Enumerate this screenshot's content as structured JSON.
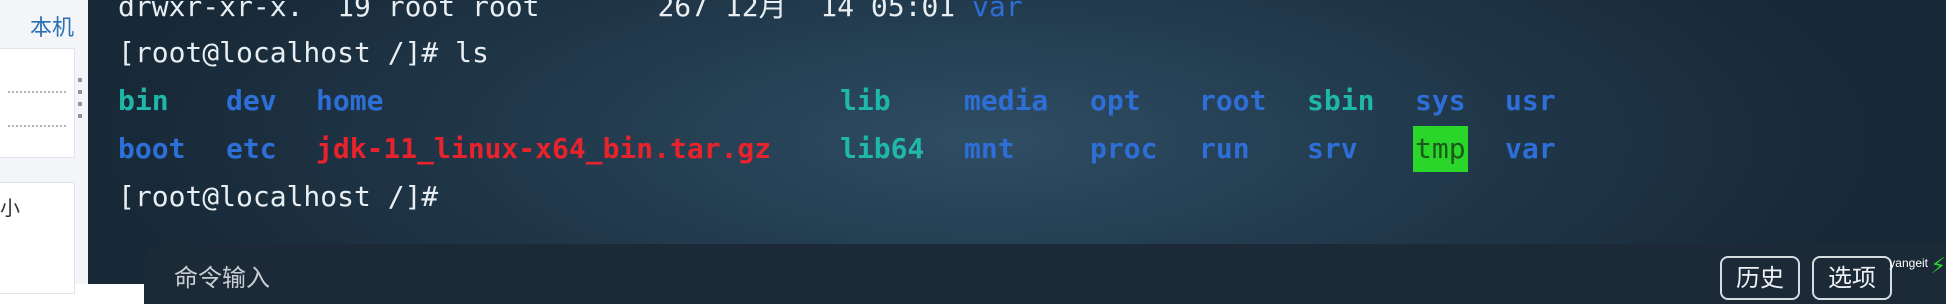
{
  "sidebar": {
    "top_label": "本机",
    "small_label": "小"
  },
  "terminal": {
    "prev_line": {
      "perms": "drwxr-xr-x.  19 root root       267 12月  14 05:01 ",
      "name": "var"
    },
    "prompt1": "[root@localhost /]# ls",
    "prompt2": "[root@localhost /]#",
    "ls_row1": [
      "bin",
      "dev",
      "home",
      "lib",
      "media",
      "opt",
      "root",
      "sbin",
      "sys",
      "usr"
    ],
    "ls_row2": [
      "boot",
      "etc",
      "jdk-11_linux-x64_bin.tar.gz",
      "lib64",
      "mnt",
      "proc",
      "run",
      "srv",
      "tmp",
      "var"
    ]
  },
  "colors": {
    "directory": "#2d6fd6",
    "symlink": "#1fb8a8",
    "archive": "#e8232b",
    "sticky_dir_bg": "#2bd62b"
  },
  "command_bar": {
    "placeholder": "命令输入",
    "history_label": "历史",
    "options_label": "选项"
  },
  "badge": {
    "text": "yangeit"
  }
}
